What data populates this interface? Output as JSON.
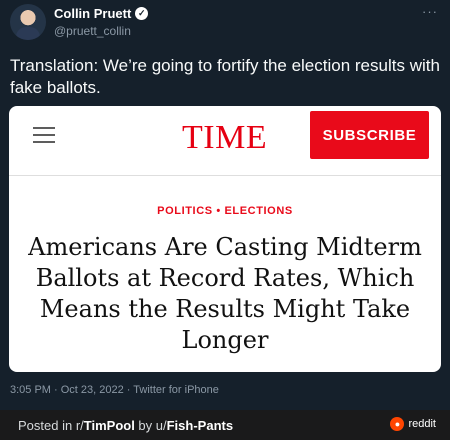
{
  "tweet": {
    "author_name": "Collin Pruett",
    "handle": "@pruett_collin",
    "more_glyph": "···",
    "verified_glyph": "✓",
    "text": "Translation: We’re going to fortify the election results with fake ballots.",
    "meta": "3:05 PM · Oct 23, 2022 · Twitter for iPhone"
  },
  "article_card": {
    "logo": "TIME",
    "subscribe_label": "SUBSCRIBE",
    "category": "POLITICS • ELECTIONS",
    "headline": "Americans Are Casting Midterm Ballots at Record Rates, Which Means the Results Might Take Longer"
  },
  "footer": {
    "posted_prefix": "Posted in r/",
    "subreddit": "TimPool",
    "by_text": " by u/",
    "username": "Fish-Pants",
    "reddit_label": "reddit"
  },
  "colors": {
    "background": "#15202b",
    "time_red": "#e90a1a",
    "footer_bg": "#1a1a1b",
    "reddit_orange": "#ff4500"
  },
  "icons": [
    "avatar",
    "verified-icon",
    "more-icon",
    "hamburger-menu-icon",
    "reddit-icon"
  ]
}
